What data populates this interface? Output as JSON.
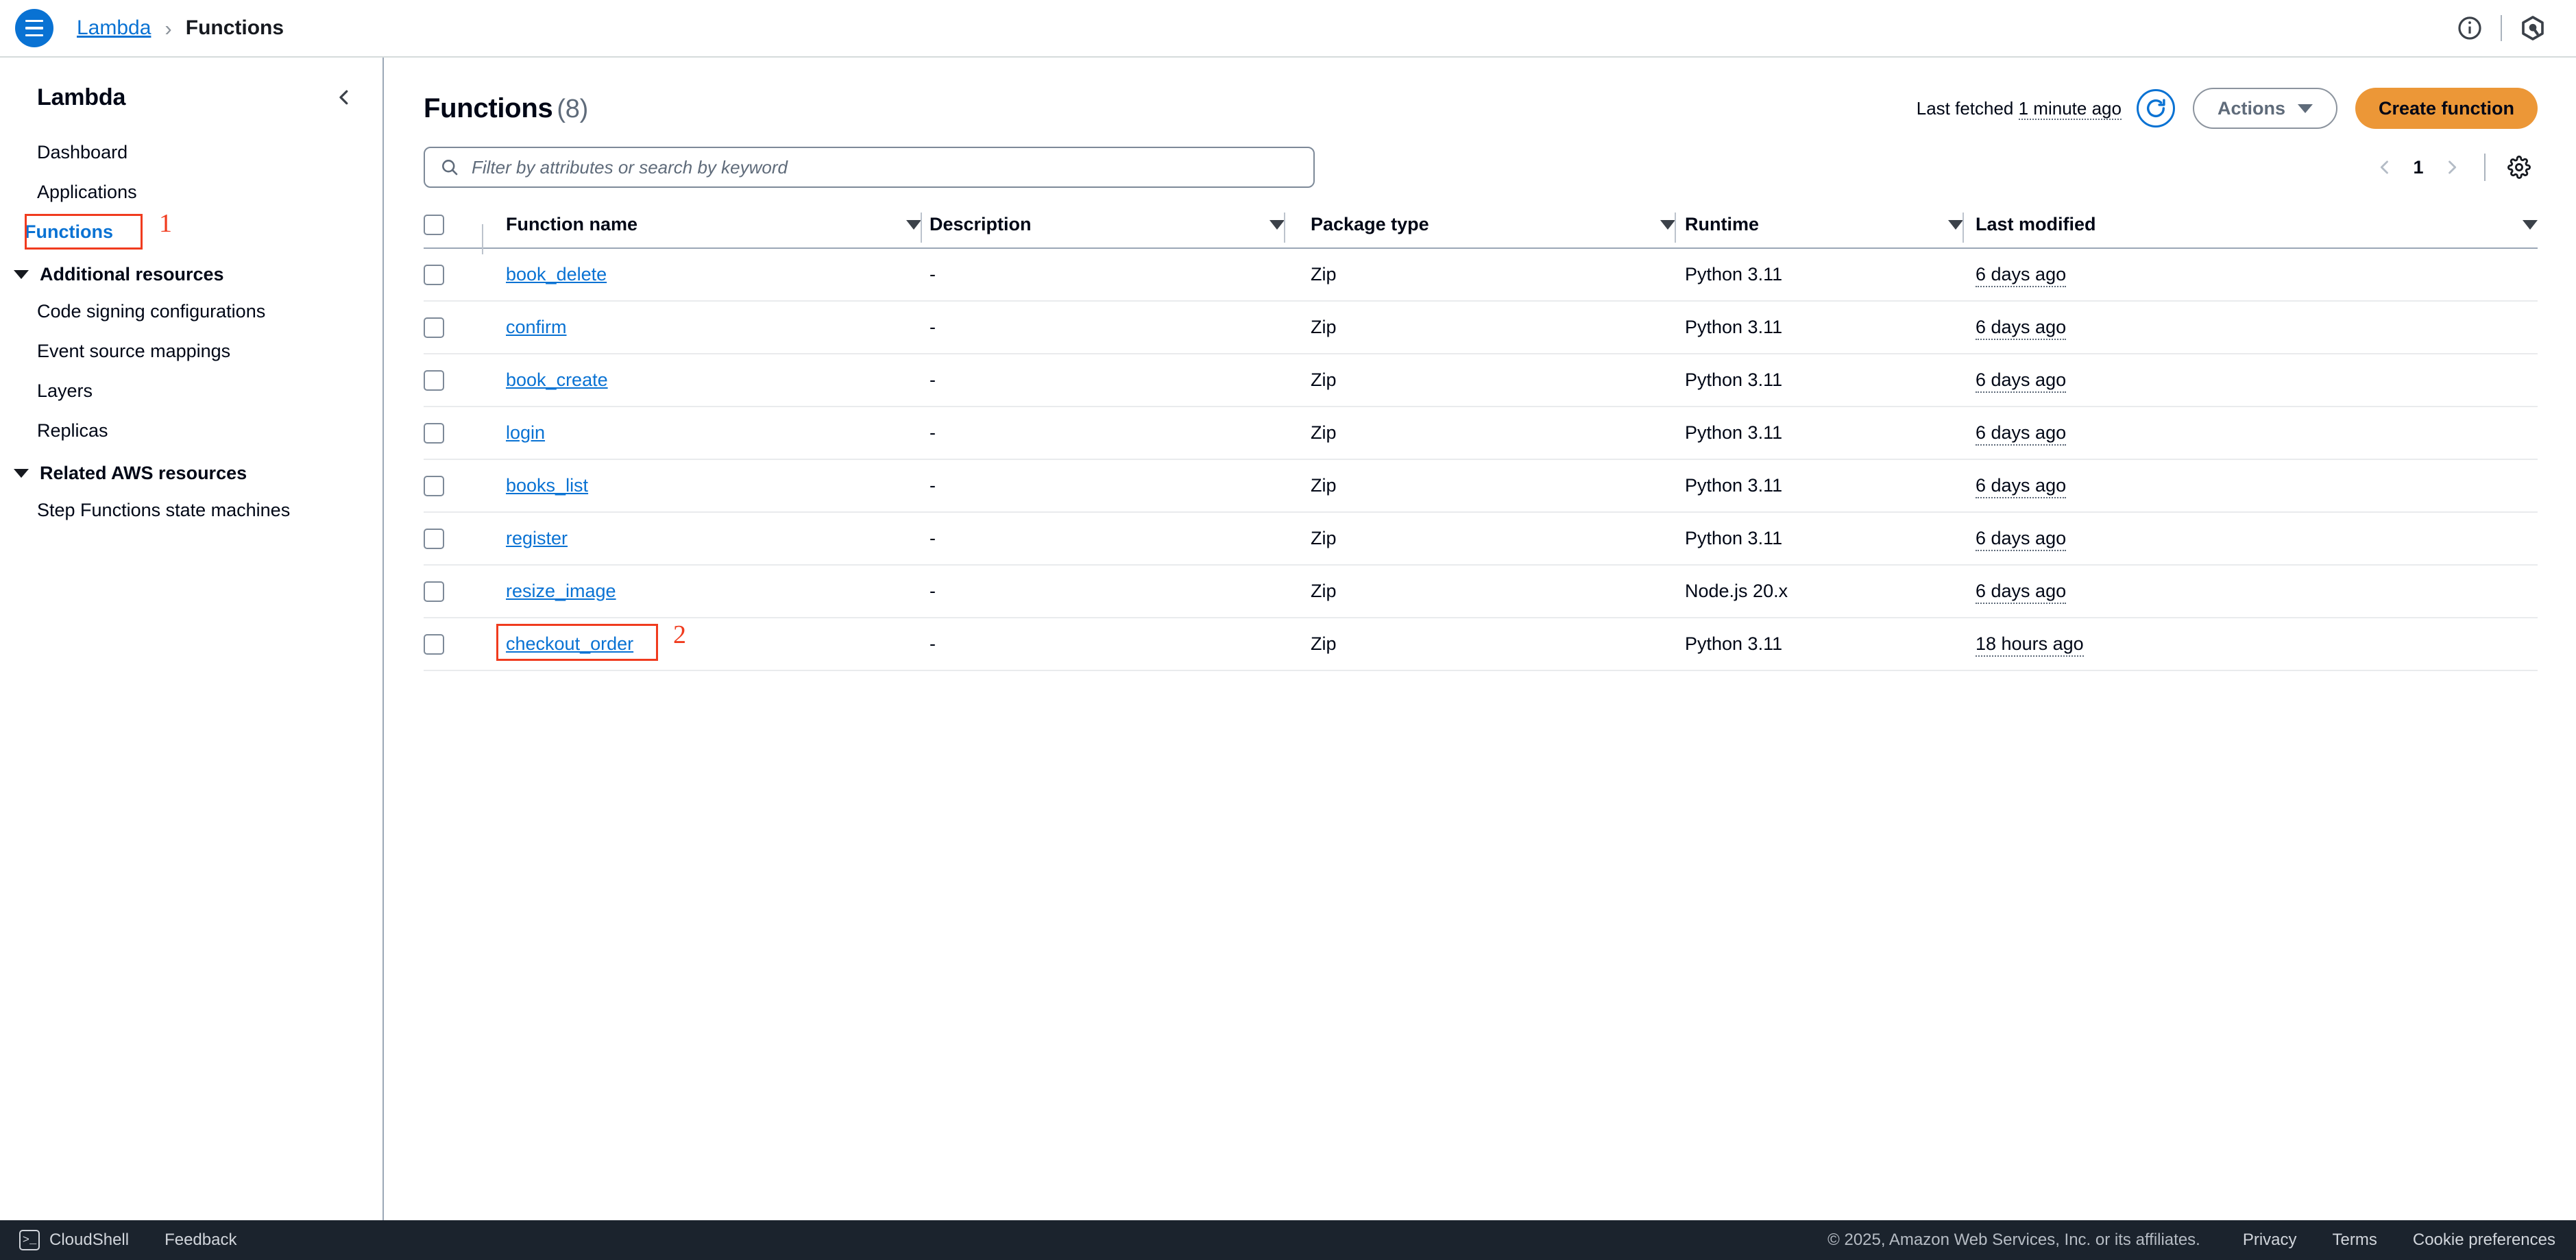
{
  "topnav": {
    "menu_icon": "hamburger-icon",
    "breadcrumb": {
      "service": "Lambda",
      "separator": "›",
      "current": "Functions"
    },
    "info_icon": "info-icon",
    "assistant_icon": "aws-q-hexagon-icon"
  },
  "sidebar": {
    "title": "Lambda",
    "collapse_icon": "chevron-left-icon",
    "items": [
      {
        "label": "Dashboard",
        "active": false
      },
      {
        "label": "Applications",
        "active": false
      },
      {
        "label": "Functions",
        "active": true
      }
    ],
    "sections": [
      {
        "label": "Additional resources",
        "items": [
          {
            "label": "Code signing configurations"
          },
          {
            "label": "Event source mappings"
          },
          {
            "label": "Layers"
          },
          {
            "label": "Replicas"
          }
        ]
      },
      {
        "label": "Related AWS resources",
        "items": [
          {
            "label": "Step Functions state machines"
          }
        ]
      }
    ]
  },
  "annotations": [
    {
      "number": "1",
      "target": "sidebar-functions-link",
      "color": "#f03b1e"
    },
    {
      "number": "2",
      "target": "function-link-checkout_order",
      "color": "#f03b1e"
    }
  ],
  "header": {
    "title": "Functions",
    "count": "(8)",
    "last_fetched_label": "Last fetched",
    "last_fetched_time": "1 minute ago",
    "refresh_icon": "refresh-icon",
    "actions_label": "Actions",
    "create_label": "Create function",
    "create_color": "#ec9737"
  },
  "search": {
    "placeholder": "Filter by attributes or search by keyword",
    "value": "",
    "icon": "search-icon"
  },
  "pagination": {
    "prev_icon": "chevron-left-icon",
    "page": "1",
    "next_icon": "chevron-right-icon",
    "settings_icon": "gear-icon"
  },
  "table": {
    "columns": [
      {
        "key": "select",
        "label": ""
      },
      {
        "key": "name",
        "label": "Function name"
      },
      {
        "key": "desc",
        "label": "Description"
      },
      {
        "key": "pkg",
        "label": "Package type"
      },
      {
        "key": "runtime",
        "label": "Runtime"
      },
      {
        "key": "modified",
        "label": "Last modified"
      }
    ],
    "rows": [
      {
        "name": "book_delete",
        "desc": "-",
        "pkg": "Zip",
        "runtime": "Python 3.11",
        "modified": "6 days ago"
      },
      {
        "name": "confirm",
        "desc": "-",
        "pkg": "Zip",
        "runtime": "Python 3.11",
        "modified": "6 days ago"
      },
      {
        "name": "book_create",
        "desc": "-",
        "pkg": "Zip",
        "runtime": "Python 3.11",
        "modified": "6 days ago"
      },
      {
        "name": "login",
        "desc": "-",
        "pkg": "Zip",
        "runtime": "Python 3.11",
        "modified": "6 days ago"
      },
      {
        "name": "books_list",
        "desc": "-",
        "pkg": "Zip",
        "runtime": "Python 3.11",
        "modified": "6 days ago"
      },
      {
        "name": "register",
        "desc": "-",
        "pkg": "Zip",
        "runtime": "Python 3.11",
        "modified": "6 days ago"
      },
      {
        "name": "resize_image",
        "desc": "-",
        "pkg": "Zip",
        "runtime": "Node.js 20.x",
        "modified": "6 days ago"
      },
      {
        "name": "checkout_order",
        "desc": "-",
        "pkg": "Zip",
        "runtime": "Python 3.11",
        "modified": "18 hours ago"
      }
    ]
  },
  "footer": {
    "cloudshell": "CloudShell",
    "feedback": "Feedback",
    "copyright": "© 2025, Amazon Web Services, Inc. or its affiliates.",
    "privacy": "Privacy",
    "terms": "Terms",
    "cookies": "Cookie preferences"
  }
}
